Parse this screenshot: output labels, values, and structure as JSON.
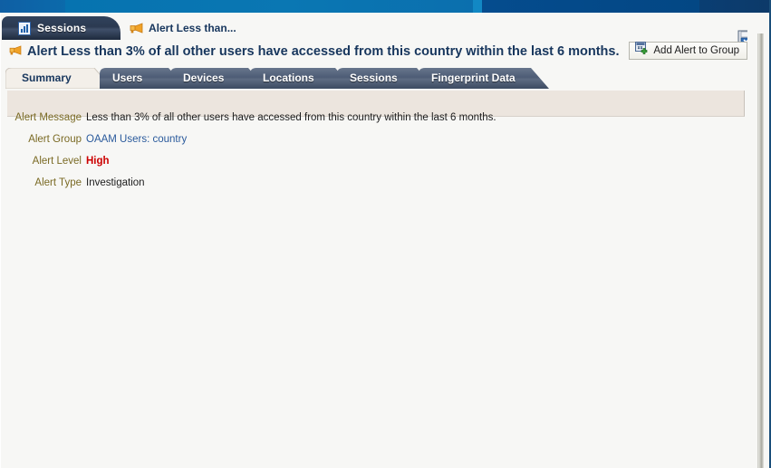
{
  "brandbar": {
    "name": "oracle-brand-bar"
  },
  "apptabs": {
    "sessions": {
      "label": "Sessions",
      "icon": "chart-document-icon"
    },
    "alert": {
      "label": "Alert Less than...",
      "icon": "megaphone-icon"
    },
    "save": {
      "icon": "save-disk-icon"
    }
  },
  "header": {
    "icon": "megaphone-icon",
    "title": "Alert Less than 3% of all other users have accessed from this country within the last 6 months.",
    "add_to_group_button": {
      "label": "Add Alert to Group",
      "icon": "add-to-group-icon"
    }
  },
  "subtabs": [
    {
      "label": "Summary",
      "active": true
    },
    {
      "label": "Users",
      "active": false
    },
    {
      "label": "Devices",
      "active": false
    },
    {
      "label": "Locations",
      "active": false
    },
    {
      "label": "Sessions",
      "active": false
    },
    {
      "label": "Fingerprint Data",
      "active": false
    }
  ],
  "details": [
    {
      "label": "Alert Message",
      "value": "Less than 3% of all other users have accessed from this country within the last 6 months.",
      "kind": "text"
    },
    {
      "label": "Alert Group",
      "value": "OAAM Users: country",
      "kind": "link"
    },
    {
      "label": "Alert Level",
      "value": "High",
      "kind": "level-high"
    },
    {
      "label": "Alert Type",
      "value": "Investigation",
      "kind": "text"
    }
  ],
  "colors": {
    "brand_blue": "#0673b0",
    "title_navy": "#17365d",
    "label_olive": "#7a6a24",
    "link_blue": "#2a5a9c",
    "level_high_red": "#cc0000",
    "panel_beige": "#ece5de",
    "tab_slate": "#50607a"
  }
}
